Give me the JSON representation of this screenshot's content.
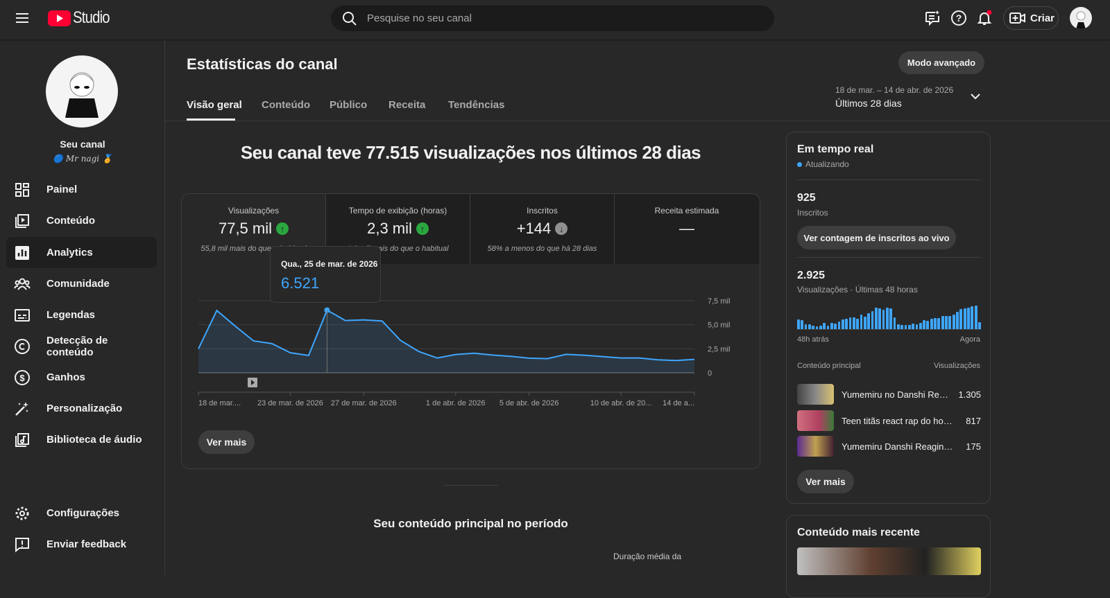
{
  "header": {
    "logo_text": "Studio",
    "search_placeholder": "Pesquise no seu canal",
    "create_label": "Criar"
  },
  "sidebar": {
    "channel_label": "Seu canal",
    "channel_name": "Mr nagi",
    "items": [
      {
        "label": "Painel"
      },
      {
        "label": "Conteúdo"
      },
      {
        "label": "Analytics"
      },
      {
        "label": "Comunidade"
      },
      {
        "label": "Legendas"
      },
      {
        "label": "Detecção de conteúdo"
      },
      {
        "label": "Ganhos"
      },
      {
        "label": "Personalização"
      },
      {
        "label": "Biblioteca de áudio"
      }
    ],
    "bottom": [
      {
        "label": "Configurações"
      },
      {
        "label": "Enviar feedback"
      }
    ]
  },
  "page": {
    "title": "Estatísticas do canal",
    "advanced_mode": "Modo avançado",
    "tabs": [
      "Visão geral",
      "Conteúdo",
      "Público",
      "Receita",
      "Tendências"
    ],
    "date_range": "18 de mar. – 14 de abr. de 2026",
    "period": "Últimos 28 dias",
    "headline": "Seu canal teve 77.515 visualizações nos últimos 28 dias",
    "see_more": "Ver mais",
    "section_title": "Seu conteúdo principal no período",
    "col_header": "Duração média da"
  },
  "metrics": [
    {
      "label": "Visualizações",
      "value": "77,5 mil",
      "trend": "up",
      "sub": "55,8 mil mais do que o habitual"
    },
    {
      "label": "Tempo de exibição (horas)",
      "value": "2,3 mil",
      "trend": "up",
      "sub": "1,0 mil mais do que o habitual"
    },
    {
      "label": "Inscritos",
      "value": "+144",
      "trend": "down",
      "sub": "58% a menos do que há 28 dias"
    },
    {
      "label": "Receita estimada",
      "value": "—",
      "trend": "none",
      "sub": ""
    }
  ],
  "tooltip": {
    "date": "Qua., 25 de mar. de 2026",
    "value": "6.521"
  },
  "chart_data": {
    "type": "area",
    "title": "Visualizações",
    "x_start": "18 de mar. de 2026",
    "x_end": "14 de abr. de 2026",
    "values": [
      2490,
      6480,
      4870,
      3320,
      3040,
      2090,
      1800,
      6521,
      5440,
      5510,
      5390,
      3370,
      2210,
      1540,
      1900,
      2040,
      1850,
      1710,
      1520,
      1470,
      1920,
      1830,
      1690,
      1540,
      1540,
      1350,
      1280,
      1400
    ],
    "ylim": [
      0,
      7500
    ],
    "yticks": [
      "0",
      "2,5 mil",
      "5,0 mil",
      "7,5 mil"
    ],
    "xticks": [
      {
        "i": 0,
        "label": "18 de mar...."
      },
      {
        "i": 5,
        "label": "23 de mar. de 2026"
      },
      {
        "i": 9,
        "label": "27 de mar. de 2026"
      },
      {
        "i": 14,
        "label": "1 de abr. de 2026"
      },
      {
        "i": 18,
        "label": "5 de abr. de 2026"
      },
      {
        "i": 23,
        "label": "10 de abr. de 20..."
      },
      {
        "i": 27,
        "label": "14 de a..."
      }
    ],
    "highlight_index": 7,
    "color": "#3ea6ff"
  },
  "realtime": {
    "title": "Em tempo real",
    "status": "Atualizando",
    "subs": "925",
    "subs_label": "Inscritos",
    "live_button": "Ver contagem de inscritos ao vivo",
    "views": "2.925",
    "views_label": "Visualizações · Últimas 48 horas",
    "start_label": "48h atrás",
    "end_label": "Agora",
    "bars": [
      35,
      32,
      18,
      16,
      13,
      10,
      12,
      22,
      12,
      22,
      20,
      27,
      35,
      37,
      40,
      40,
      37,
      50,
      43,
      55,
      62,
      75,
      72,
      68,
      75,
      72,
      40,
      17,
      14,
      14,
      14,
      20,
      18,
      22,
      32,
      30,
      37,
      38,
      38,
      45,
      45,
      45,
      50,
      60,
      70,
      73,
      75,
      80,
      82,
      25
    ],
    "col_content": "Conteúdo principal",
    "col_views": "Visualizações",
    "top": [
      {
        "title": "Yumemiru no Danshi Reagindo",
        "views": "1.305"
      },
      {
        "title": "Teen titãs react rap do homem-aranha",
        "views": "817"
      },
      {
        "title": "Yumemiru Danshi Reagindo",
        "views": "175"
      }
    ],
    "see_more": "Ver mais"
  },
  "recent": {
    "title": "Conteúdo mais recente"
  }
}
